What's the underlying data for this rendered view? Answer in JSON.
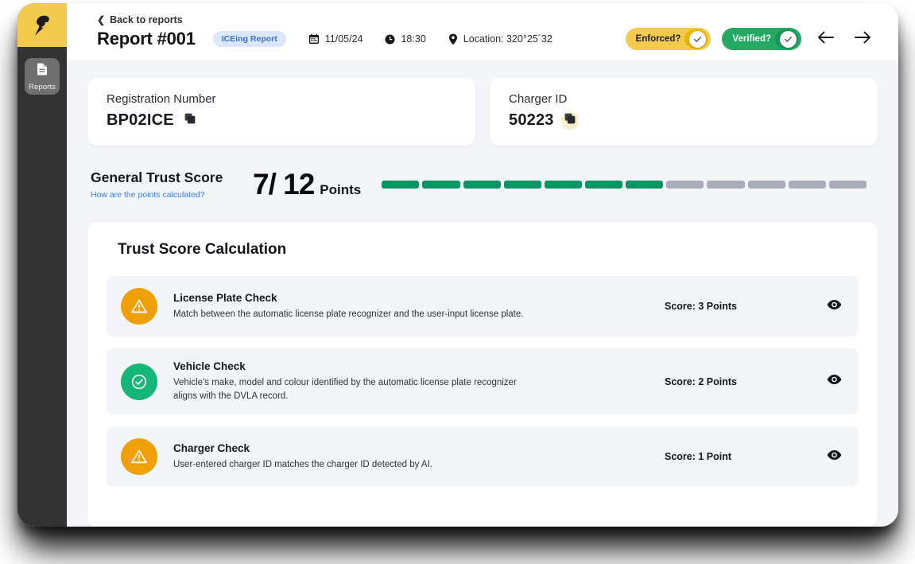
{
  "sidebar": {
    "logo_icon": "lightning-bolt-icon",
    "items": [
      {
        "label": "Reports",
        "icon": "document-icon",
        "active": true
      }
    ]
  },
  "header": {
    "back_label": "Back to reports",
    "back_icon": "chevron-left-icon",
    "title": "Report #001",
    "report_type_badge": "ICEing Report",
    "meta": [
      {
        "icon": "calendar-icon",
        "text": "11/05/24"
      },
      {
        "icon": "clock-icon",
        "text": "18:30"
      },
      {
        "icon": "map-pin-icon",
        "text": "Location: 320°25´32"
      }
    ],
    "toggles": [
      {
        "label": "Enforced?",
        "on": true,
        "color": "#f2cb4d",
        "knob_icon": "check-icon"
      },
      {
        "label": "Verified?",
        "on": true,
        "color": "#23a963",
        "knob_icon": "check-icon"
      }
    ],
    "nav_prev_icon": "arrow-left-icon",
    "nav_next_icon": "arrow-right-icon"
  },
  "info_cards": [
    {
      "label": "Registration Number",
      "value": "BP02ICE",
      "copy_icon": "copy-icon",
      "copy_highlighted": false
    },
    {
      "label": "Charger ID",
      "value": "50223",
      "copy_icon": "copy-icon",
      "copy_highlighted": true
    }
  ],
  "trust_score": {
    "title": "General Trust Score",
    "help_link": "How are the points calculated?",
    "score": "7/ 12",
    "points_label": "Points",
    "earned": 7,
    "total": 12,
    "filled_color": "#069465",
    "empty_color": "#a9adb8"
  },
  "calculation": {
    "title": "Trust Score Calculation",
    "rows": [
      {
        "status": "warn",
        "icon": "warning-triangle-icon",
        "title": "License Plate Check",
        "description": "Match between the automatic license plate recognizer and the user-input license plate.",
        "score": "Score: 3 Points",
        "eye_icon": "eye-icon"
      },
      {
        "status": "ok",
        "icon": "check-circle-icon",
        "title": "Vehicle Check",
        "description": "Vehicle's make, model and colour identified by the automatic license plate recognizer aligns with the DVLA record.",
        "score": "Score: 2 Points",
        "eye_icon": "eye-icon"
      },
      {
        "status": "warn",
        "icon": "warning-triangle-icon",
        "title": "Charger Check",
        "description": "User-entered charger ID matches the charger ID detected by AI.",
        "score": "Score: 1 Point",
        "eye_icon": "eye-icon"
      }
    ]
  }
}
